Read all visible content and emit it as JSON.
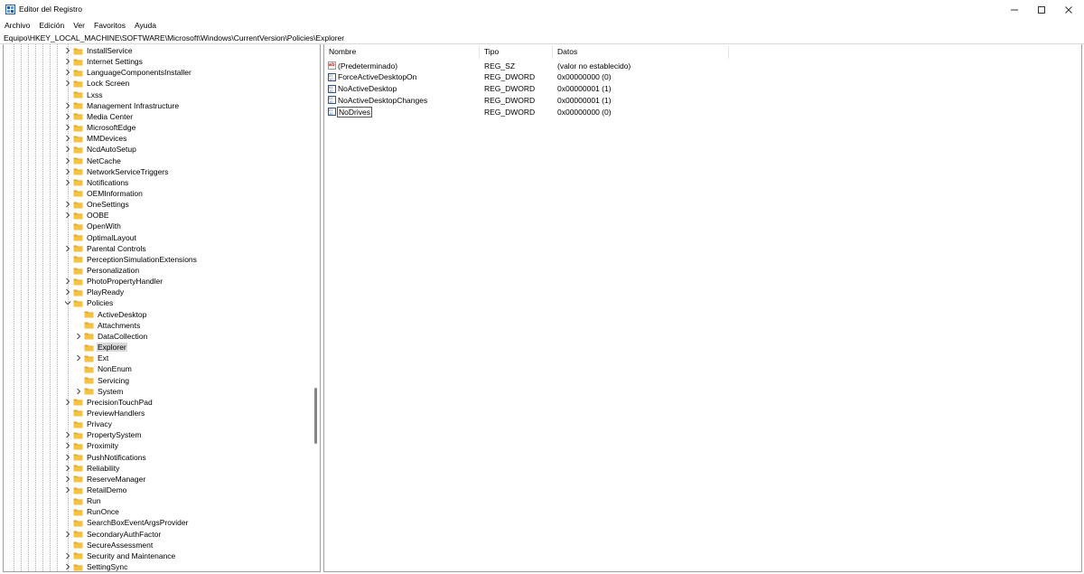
{
  "window": {
    "title": "Editor del Registro"
  },
  "menu": [
    "Archivo",
    "Edición",
    "Ver",
    "Favoritos",
    "Ayuda"
  ],
  "address": "Equipo\\HKEY_LOCAL_MACHINE\\SOFTWARE\\Microsoft\\Windows\\CurrentVersion\\Policies\\Explorer",
  "tree": [
    {
      "label": "InstallService",
      "level": 0,
      "expander": "collapsed"
    },
    {
      "label": "Internet Settings",
      "level": 0,
      "expander": "collapsed"
    },
    {
      "label": "LanguageComponentsInstaller",
      "level": 0,
      "expander": "collapsed"
    },
    {
      "label": "Lock Screen",
      "level": 0,
      "expander": "collapsed"
    },
    {
      "label": "Lxss",
      "level": 0,
      "expander": "none"
    },
    {
      "label": "Management Infrastructure",
      "level": 0,
      "expander": "collapsed"
    },
    {
      "label": "Media Center",
      "level": 0,
      "expander": "collapsed"
    },
    {
      "label": "MicrosoftEdge",
      "level": 0,
      "expander": "collapsed"
    },
    {
      "label": "MMDevices",
      "level": 0,
      "expander": "collapsed"
    },
    {
      "label": "NcdAutoSetup",
      "level": 0,
      "expander": "collapsed"
    },
    {
      "label": "NetCache",
      "level": 0,
      "expander": "collapsed"
    },
    {
      "label": "NetworkServiceTriggers",
      "level": 0,
      "expander": "collapsed"
    },
    {
      "label": "Notifications",
      "level": 0,
      "expander": "collapsed"
    },
    {
      "label": "OEMInformation",
      "level": 0,
      "expander": "none"
    },
    {
      "label": "OneSettings",
      "level": 0,
      "expander": "collapsed"
    },
    {
      "label": "OOBE",
      "level": 0,
      "expander": "collapsed"
    },
    {
      "label": "OpenWith",
      "level": 0,
      "expander": "none"
    },
    {
      "label": "OptimalLayout",
      "level": 0,
      "expander": "none"
    },
    {
      "label": "Parental Controls",
      "level": 0,
      "expander": "collapsed"
    },
    {
      "label": "PerceptionSimulationExtensions",
      "level": 0,
      "expander": "none"
    },
    {
      "label": "Personalization",
      "level": 0,
      "expander": "none"
    },
    {
      "label": "PhotoPropertyHandler",
      "level": 0,
      "expander": "collapsed"
    },
    {
      "label": "PlayReady",
      "level": 0,
      "expander": "collapsed"
    },
    {
      "label": "Policies",
      "level": 0,
      "expander": "expanded"
    },
    {
      "label": "ActiveDesktop",
      "level": 1,
      "expander": "none"
    },
    {
      "label": "Attachments",
      "level": 1,
      "expander": "none"
    },
    {
      "label": "DataCollection",
      "level": 1,
      "expander": "collapsed"
    },
    {
      "label": "Explorer",
      "level": 1,
      "expander": "none",
      "selected": true
    },
    {
      "label": "Ext",
      "level": 1,
      "expander": "collapsed"
    },
    {
      "label": "NonEnum",
      "level": 1,
      "expander": "none"
    },
    {
      "label": "Servicing",
      "level": 1,
      "expander": "none"
    },
    {
      "label": "System",
      "level": 1,
      "expander": "collapsed"
    },
    {
      "label": "PrecisionTouchPad",
      "level": 0,
      "expander": "collapsed"
    },
    {
      "label": "PreviewHandlers",
      "level": 0,
      "expander": "none"
    },
    {
      "label": "Privacy",
      "level": 0,
      "expander": "none"
    },
    {
      "label": "PropertySystem",
      "level": 0,
      "expander": "collapsed"
    },
    {
      "label": "Proximity",
      "level": 0,
      "expander": "collapsed"
    },
    {
      "label": "PushNotifications",
      "level": 0,
      "expander": "collapsed"
    },
    {
      "label": "Reliability",
      "level": 0,
      "expander": "collapsed"
    },
    {
      "label": "ReserveManager",
      "level": 0,
      "expander": "collapsed"
    },
    {
      "label": "RetailDemo",
      "level": 0,
      "expander": "collapsed"
    },
    {
      "label": "Run",
      "level": 0,
      "expander": "none"
    },
    {
      "label": "RunOnce",
      "level": 0,
      "expander": "none"
    },
    {
      "label": "SearchBoxEventArgsProvider",
      "level": 0,
      "expander": "none"
    },
    {
      "label": "SecondaryAuthFactor",
      "level": 0,
      "expander": "collapsed"
    },
    {
      "label": "SecureAssessment",
      "level": 0,
      "expander": "none"
    },
    {
      "label": "Security and Maintenance",
      "level": 0,
      "expander": "collapsed"
    },
    {
      "label": "SettingSync",
      "level": 0,
      "expander": "collapsed"
    }
  ],
  "list": {
    "columns": [
      "Nombre",
      "Tipo",
      "Datos"
    ],
    "rows": [
      {
        "icon": "string-value-icon",
        "name": "(Predeterminado)",
        "type": "REG_SZ",
        "data": "(valor no establecido)"
      },
      {
        "icon": "dword-value-icon",
        "name": "ForceActiveDesktopOn",
        "type": "REG_DWORD",
        "data": "0x00000000 (0)"
      },
      {
        "icon": "dword-value-icon",
        "name": "NoActiveDesktop",
        "type": "REG_DWORD",
        "data": "0x00000001 (1)"
      },
      {
        "icon": "dword-value-icon",
        "name": "NoActiveDesktopChanges",
        "type": "REG_DWORD",
        "data": "0x00000001 (1)"
      },
      {
        "icon": "dword-value-icon",
        "name": "NoDrives",
        "type": "REG_DWORD",
        "data": "0x00000000 (0)",
        "focused": true
      }
    ]
  },
  "colors": {
    "folder": "#f5c242",
    "folder_dark": "#e0a82e",
    "selection": "#d9d9d9",
    "border": "#a0a0a0",
    "dword_icon": "#2b5797",
    "string_icon": "#c0392b"
  }
}
